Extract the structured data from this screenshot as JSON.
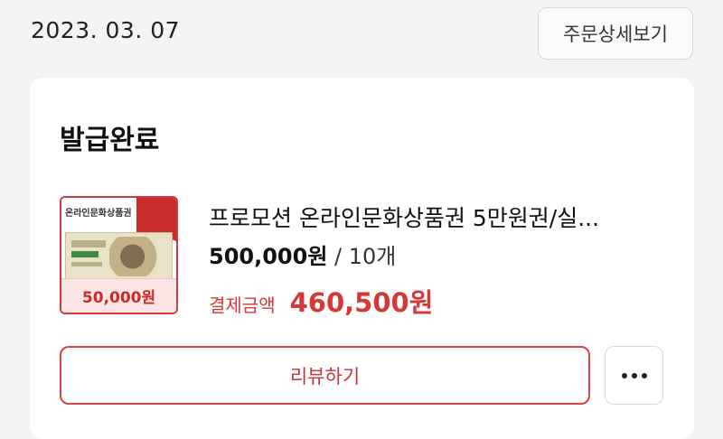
{
  "order": {
    "date": "2023. 03. 07",
    "detail_button_label": "주문상세보기"
  },
  "card": {
    "status": "발급완료",
    "product": {
      "name": "프로모션 온라인문화상품권 5만원권/실...",
      "thumbnail": {
        "brand_text": "온라인문화상품권",
        "price_text": "50,000원"
      },
      "price_amount": "500,000원",
      "quantity": " / 10개",
      "paid_label": "결제금액",
      "paid_amount": "460,500원"
    },
    "review_button_label": "리뷰하기",
    "more_icon": "more-horizontal-icon"
  },
  "colors": {
    "accent_red": "#d63838",
    "background": "#f4f4f5",
    "card": "#ffffff"
  }
}
